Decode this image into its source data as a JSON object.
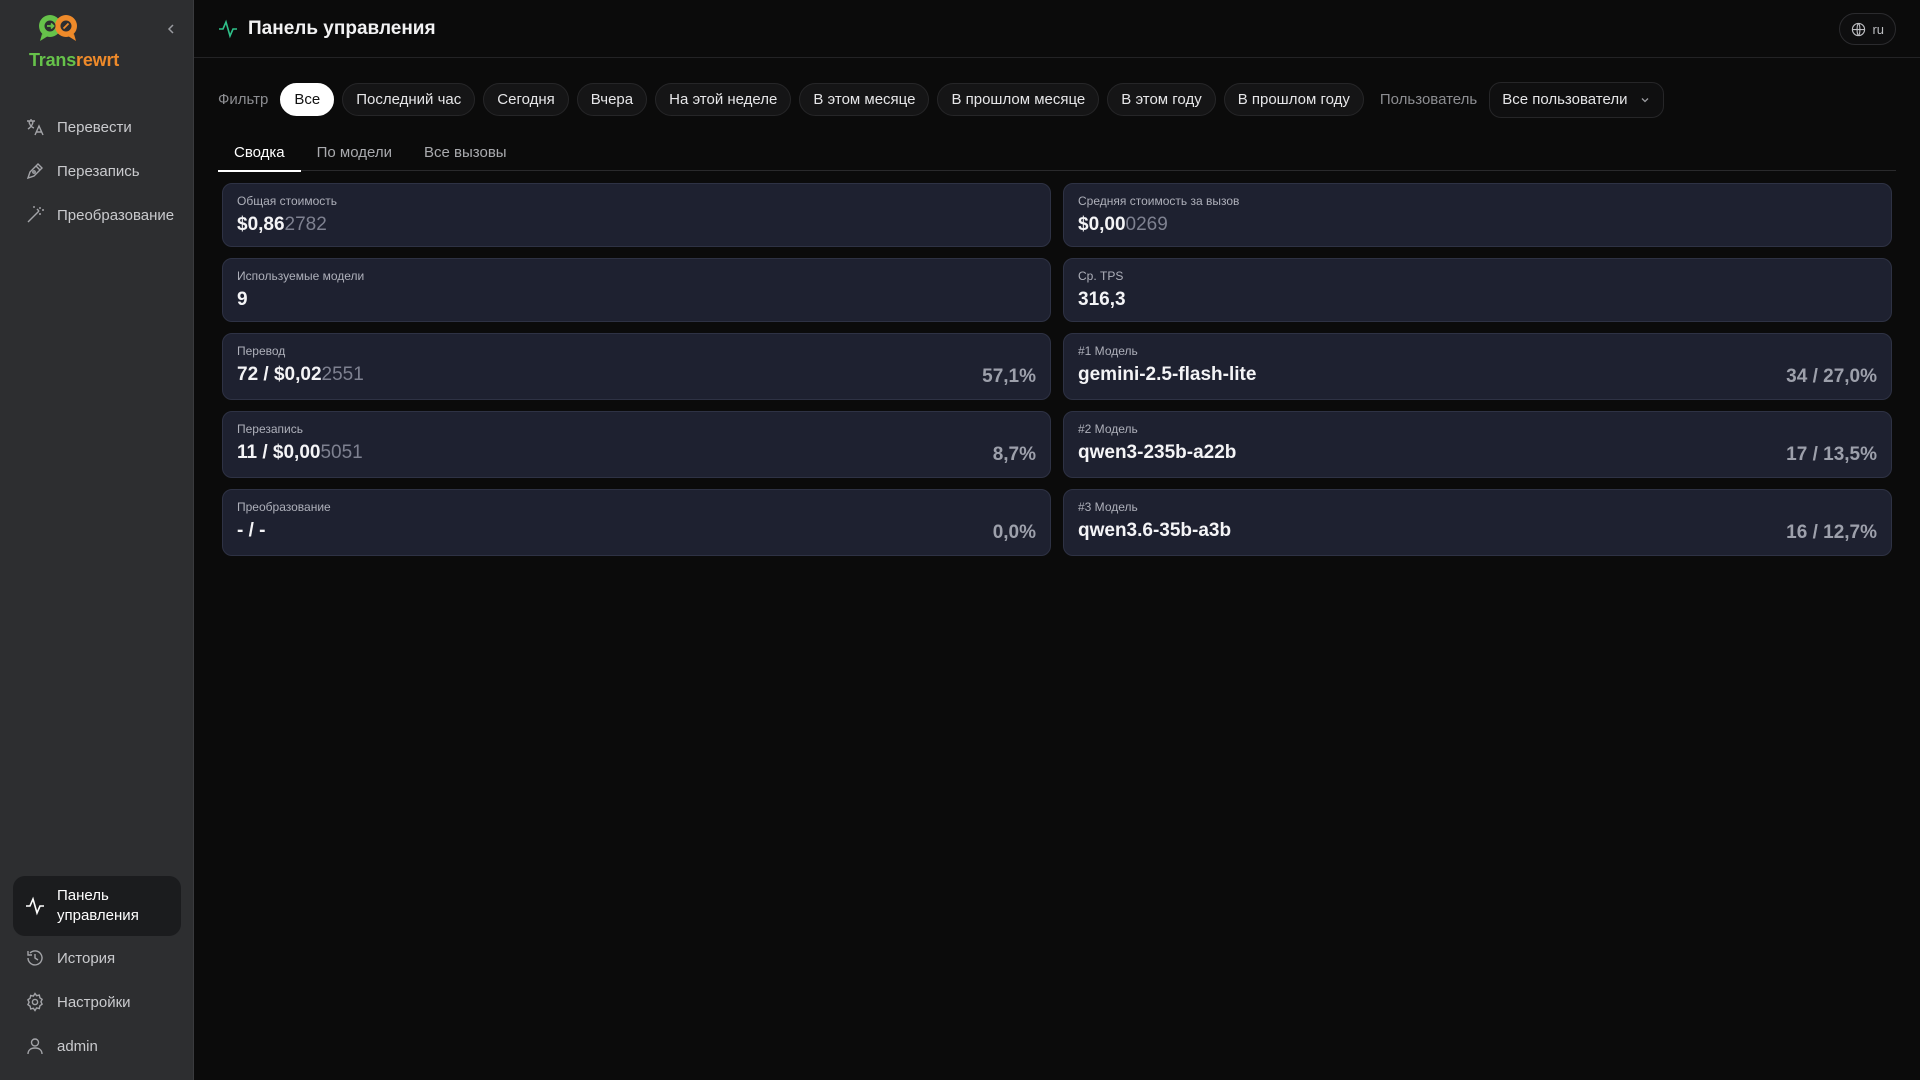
{
  "app": {
    "logo_prefix": "Trans",
    "logo_suffix": "rewrt"
  },
  "sidebar": {
    "nav": [
      {
        "label": "Перевести",
        "icon": "translate-icon"
      },
      {
        "label": "Перезапись",
        "icon": "rewrite-pen-icon"
      },
      {
        "label": "Преобразование",
        "icon": "magic-wand-icon"
      }
    ],
    "bottom": [
      {
        "label": "Панель управления",
        "icon": "activity-icon",
        "active": true
      },
      {
        "label": "История",
        "icon": "history-icon"
      },
      {
        "label": "Настройки",
        "icon": "gear-icon"
      },
      {
        "label": "admin",
        "icon": "user-icon"
      }
    ]
  },
  "header": {
    "title": "Панель управления",
    "lang": "ru"
  },
  "filters": {
    "label": "Фильтр",
    "chips": [
      "Все",
      "Последний час",
      "Сегодня",
      "Вчера",
      "На этой неделе",
      "В этом месяце",
      "В прошлом месяце",
      "В этом году",
      "В прошлом году"
    ],
    "active_index": 0,
    "user_label": "Пользователь",
    "user_value": "Все пользователи"
  },
  "tabs": {
    "items": [
      "Сводка",
      "По модели",
      "Все вызовы"
    ],
    "active_index": 0
  },
  "cards": {
    "total_cost": {
      "label": "Общая стоимость",
      "value_main": "$0,86",
      "value_dim": "2782"
    },
    "avg_cost": {
      "label": "Средняя стоимость за вызов",
      "value_main": "$0,00",
      "value_dim": "0269"
    },
    "models_used": {
      "label": "Используемые модели",
      "value": "9"
    },
    "avg_tps": {
      "label": "Ср. TPS",
      "value": "316,3"
    },
    "translate": {
      "label": "Перевод",
      "value_main": "72 / $0,02",
      "value_dim": "2551",
      "pct": "57,1%"
    },
    "rewrite": {
      "label": "Перезапись",
      "value_main": "11 / $0,00",
      "value_dim": "5051",
      "pct": "8,7%"
    },
    "transform": {
      "label": "Преобразование",
      "value_main": "- / -",
      "value_dim": "",
      "pct": "0,0%"
    },
    "model1": {
      "label": "#1 Модель",
      "value": "gemini-2.5-flash-lite",
      "pct": "34 / 27,0%"
    },
    "model2": {
      "label": "#2 Модель",
      "value": "qwen3-235b-a22b",
      "pct": "17 / 13,5%"
    },
    "model3": {
      "label": "#3 Модель",
      "value": "qwen3.6-35b-a3b",
      "pct": "16 / 12,7%"
    }
  },
  "colors": {
    "logo_green": "#66c24a",
    "logo_orange": "#ee8a2a",
    "accent_pulse": "#2fc28a",
    "card_bg": "#1e2130"
  }
}
